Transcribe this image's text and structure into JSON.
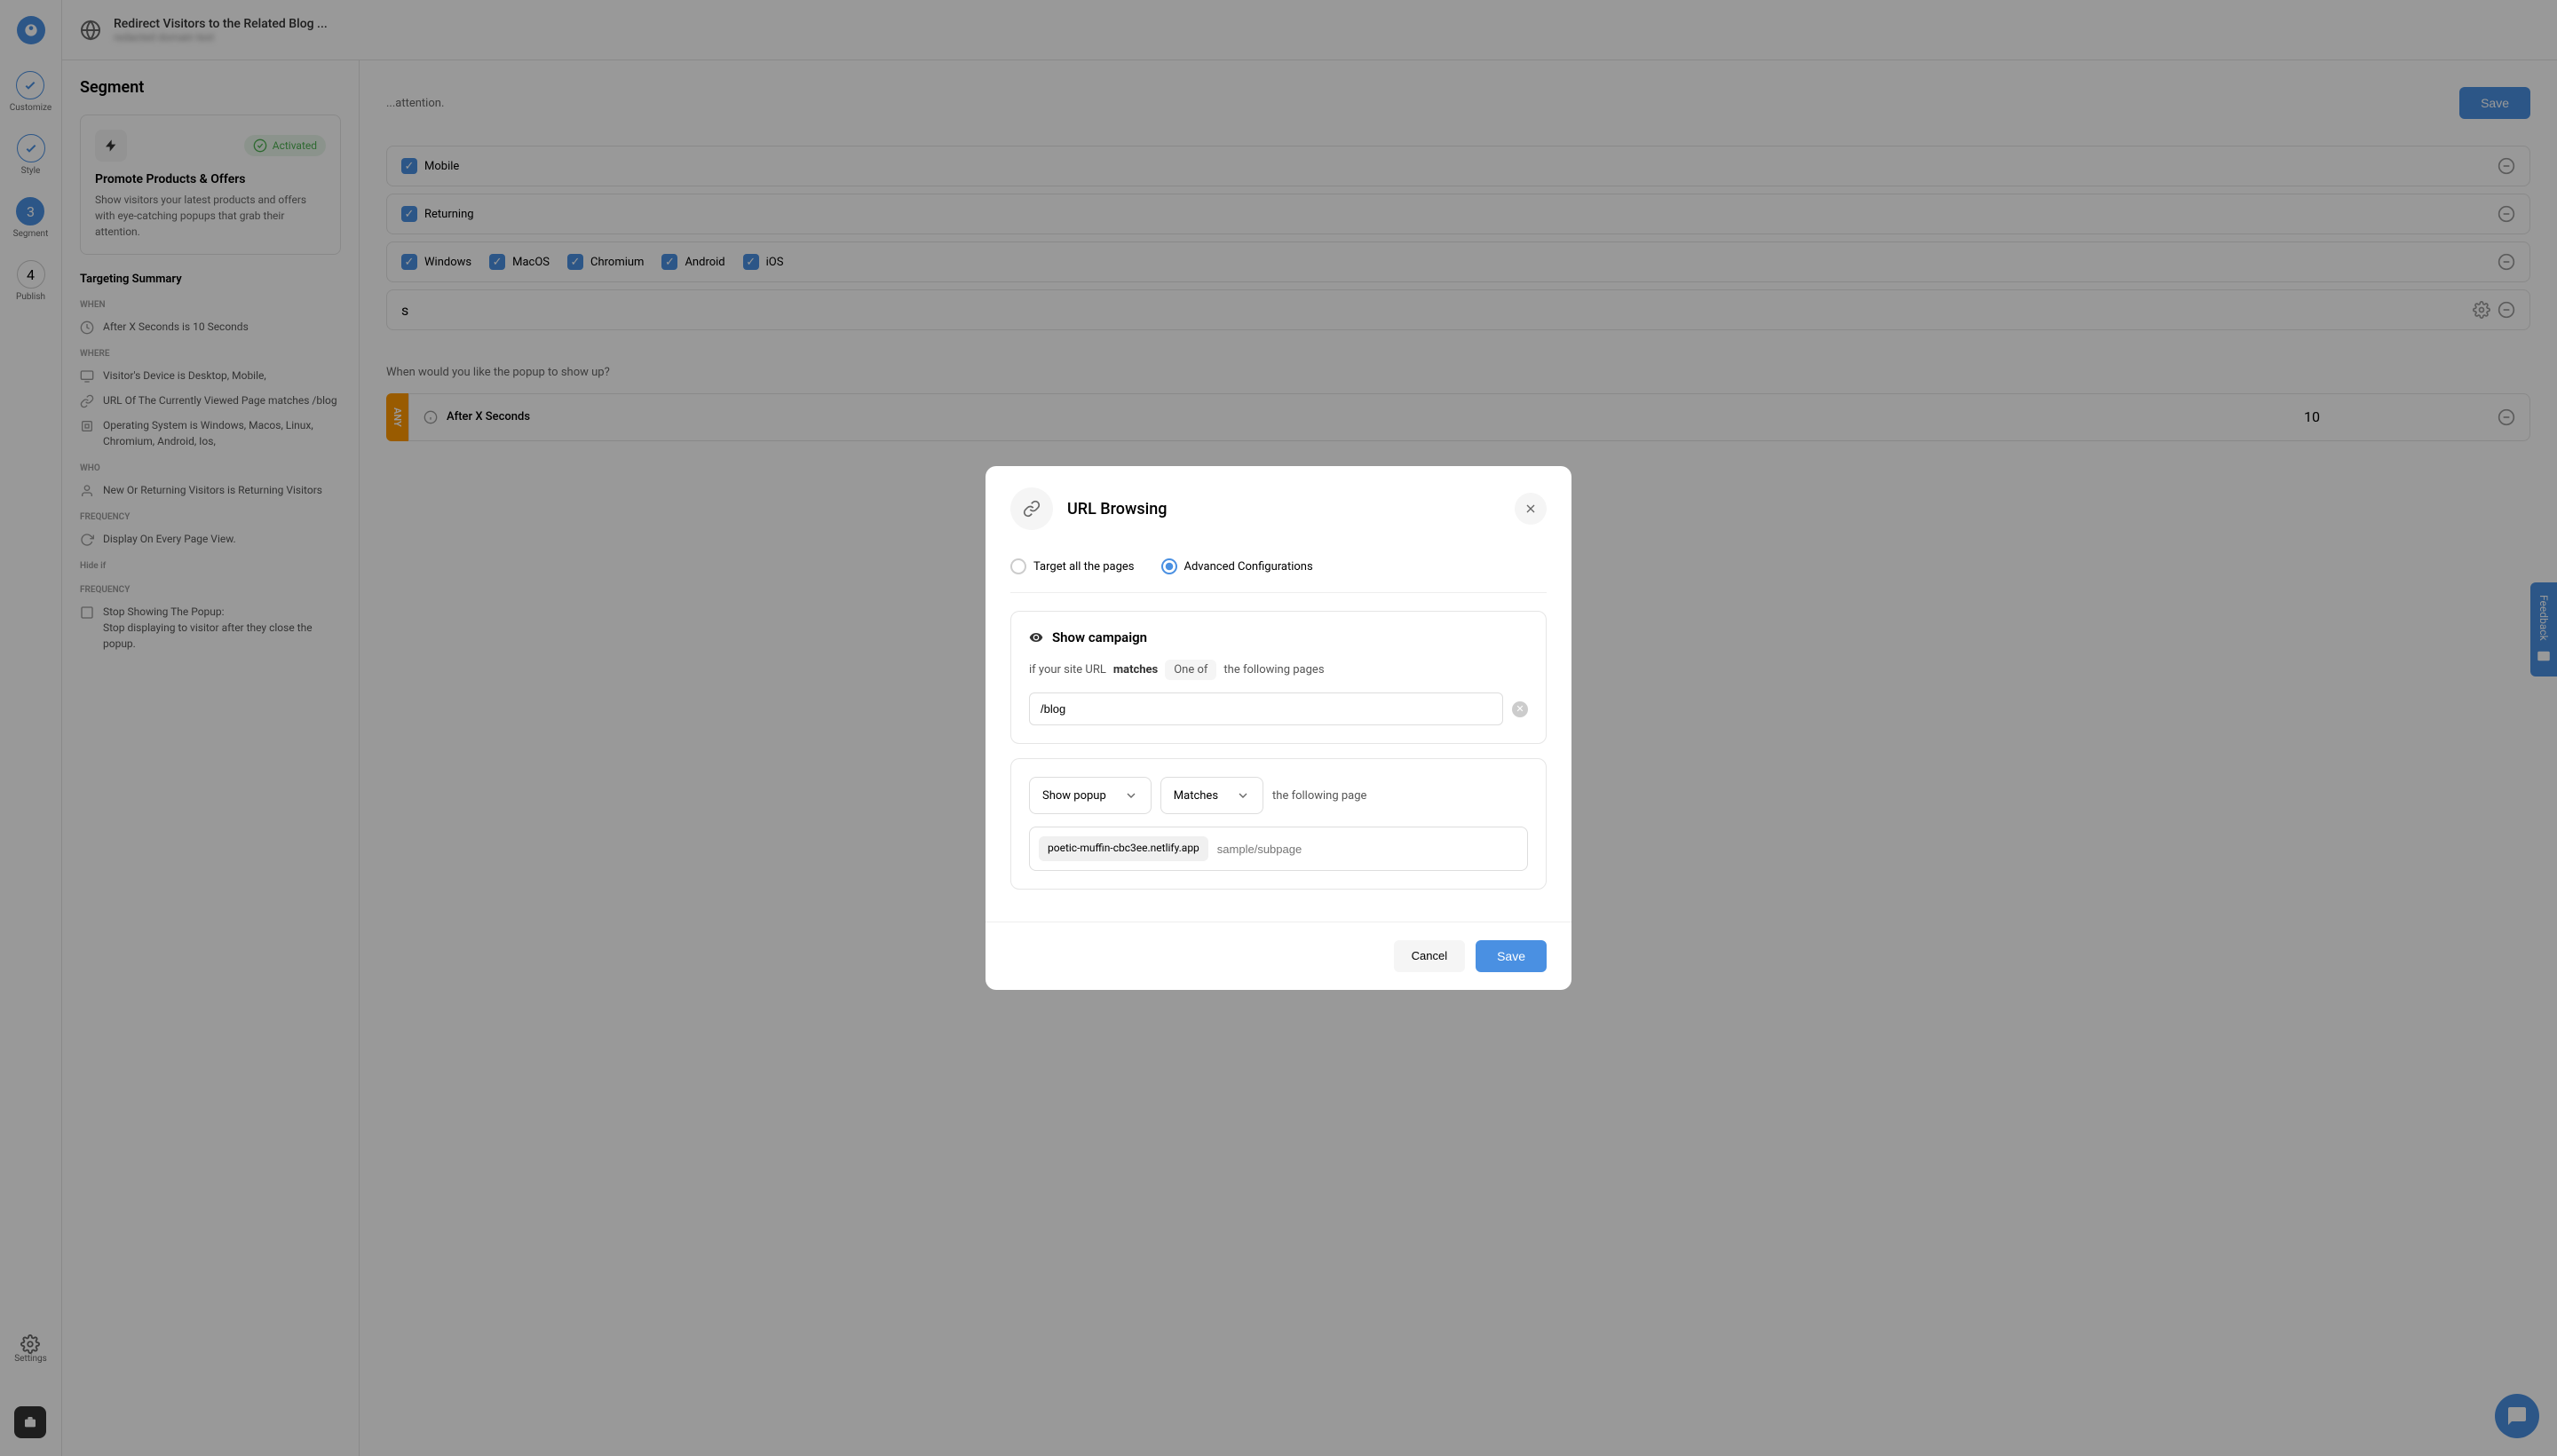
{
  "header": {
    "title": "Redirect Visitors to the Related Blog ...",
    "subtitle": "redacted domain text"
  },
  "rail": {
    "customize": "Customize",
    "style": "Style",
    "segment_num": "3",
    "segment": "Segment",
    "publish_num": "4",
    "publish": "Publish",
    "settings": "Settings"
  },
  "sidebar": {
    "heading": "Segment",
    "activated": "Activated",
    "card_title": "Promote Products & Offers",
    "card_desc": "Show visitors your latest products and offers with eye-catching popups that grab their attention.",
    "summary_title": "Targeting Summary",
    "when_label": "WHEN",
    "when_text": "After X Seconds is 10 Seconds",
    "where_label": "WHERE",
    "where_device": "Visitor's Device is Desktop, Mobile,",
    "where_url": "URL Of The Currently Viewed Page matches /blog",
    "where_os": "Operating System is Windows, Macos, Linux, Chromium, Android, Ios,",
    "who_label": "WHO",
    "who_text": "New Or Returning Visitors is Returning Visitors",
    "freq_label": "FREQUENCY",
    "freq_text": "Display On Every Page View.",
    "hide_label": "Hide if",
    "freq2_label": "FREQUENCY",
    "stop_title": "Stop Showing The Popup:",
    "stop_text": "Stop displaying to visitor after they close the popup."
  },
  "main": {
    "save_hint": "...attention.",
    "save": "Save",
    "rows": [
      {
        "opts": [
          "Mobile"
        ]
      },
      {
        "opts": [
          "Returning"
        ]
      },
      {
        "opts": [
          "Windows",
          "MacOS",
          "Chromium",
          "Android",
          "iOS"
        ]
      },
      {
        "label_suffix": "s",
        "has_gear": true
      }
    ],
    "when_q": "When would you like the popup to show up?",
    "any": "ANY",
    "after_x": "After X Seconds",
    "after_val": "10"
  },
  "modal": {
    "title": "URL Browsing",
    "radio1": "Target all the pages",
    "radio2": "Advanced Configurations",
    "show_campaign": "Show campaign",
    "sentence_prefix": "if your site URL",
    "matches": "matches",
    "one_of": "One of",
    "sentence_suffix": "the following pages",
    "blog_value": "/blog",
    "show_popup": "Show popup",
    "matches2": "Matches",
    "following_page": "the following page",
    "domain": "poetic-muffin-cbc3ee.netlify.app",
    "placeholder": "sample/subpage",
    "cancel": "Cancel",
    "save": "Save"
  },
  "feedback": "Feedback"
}
